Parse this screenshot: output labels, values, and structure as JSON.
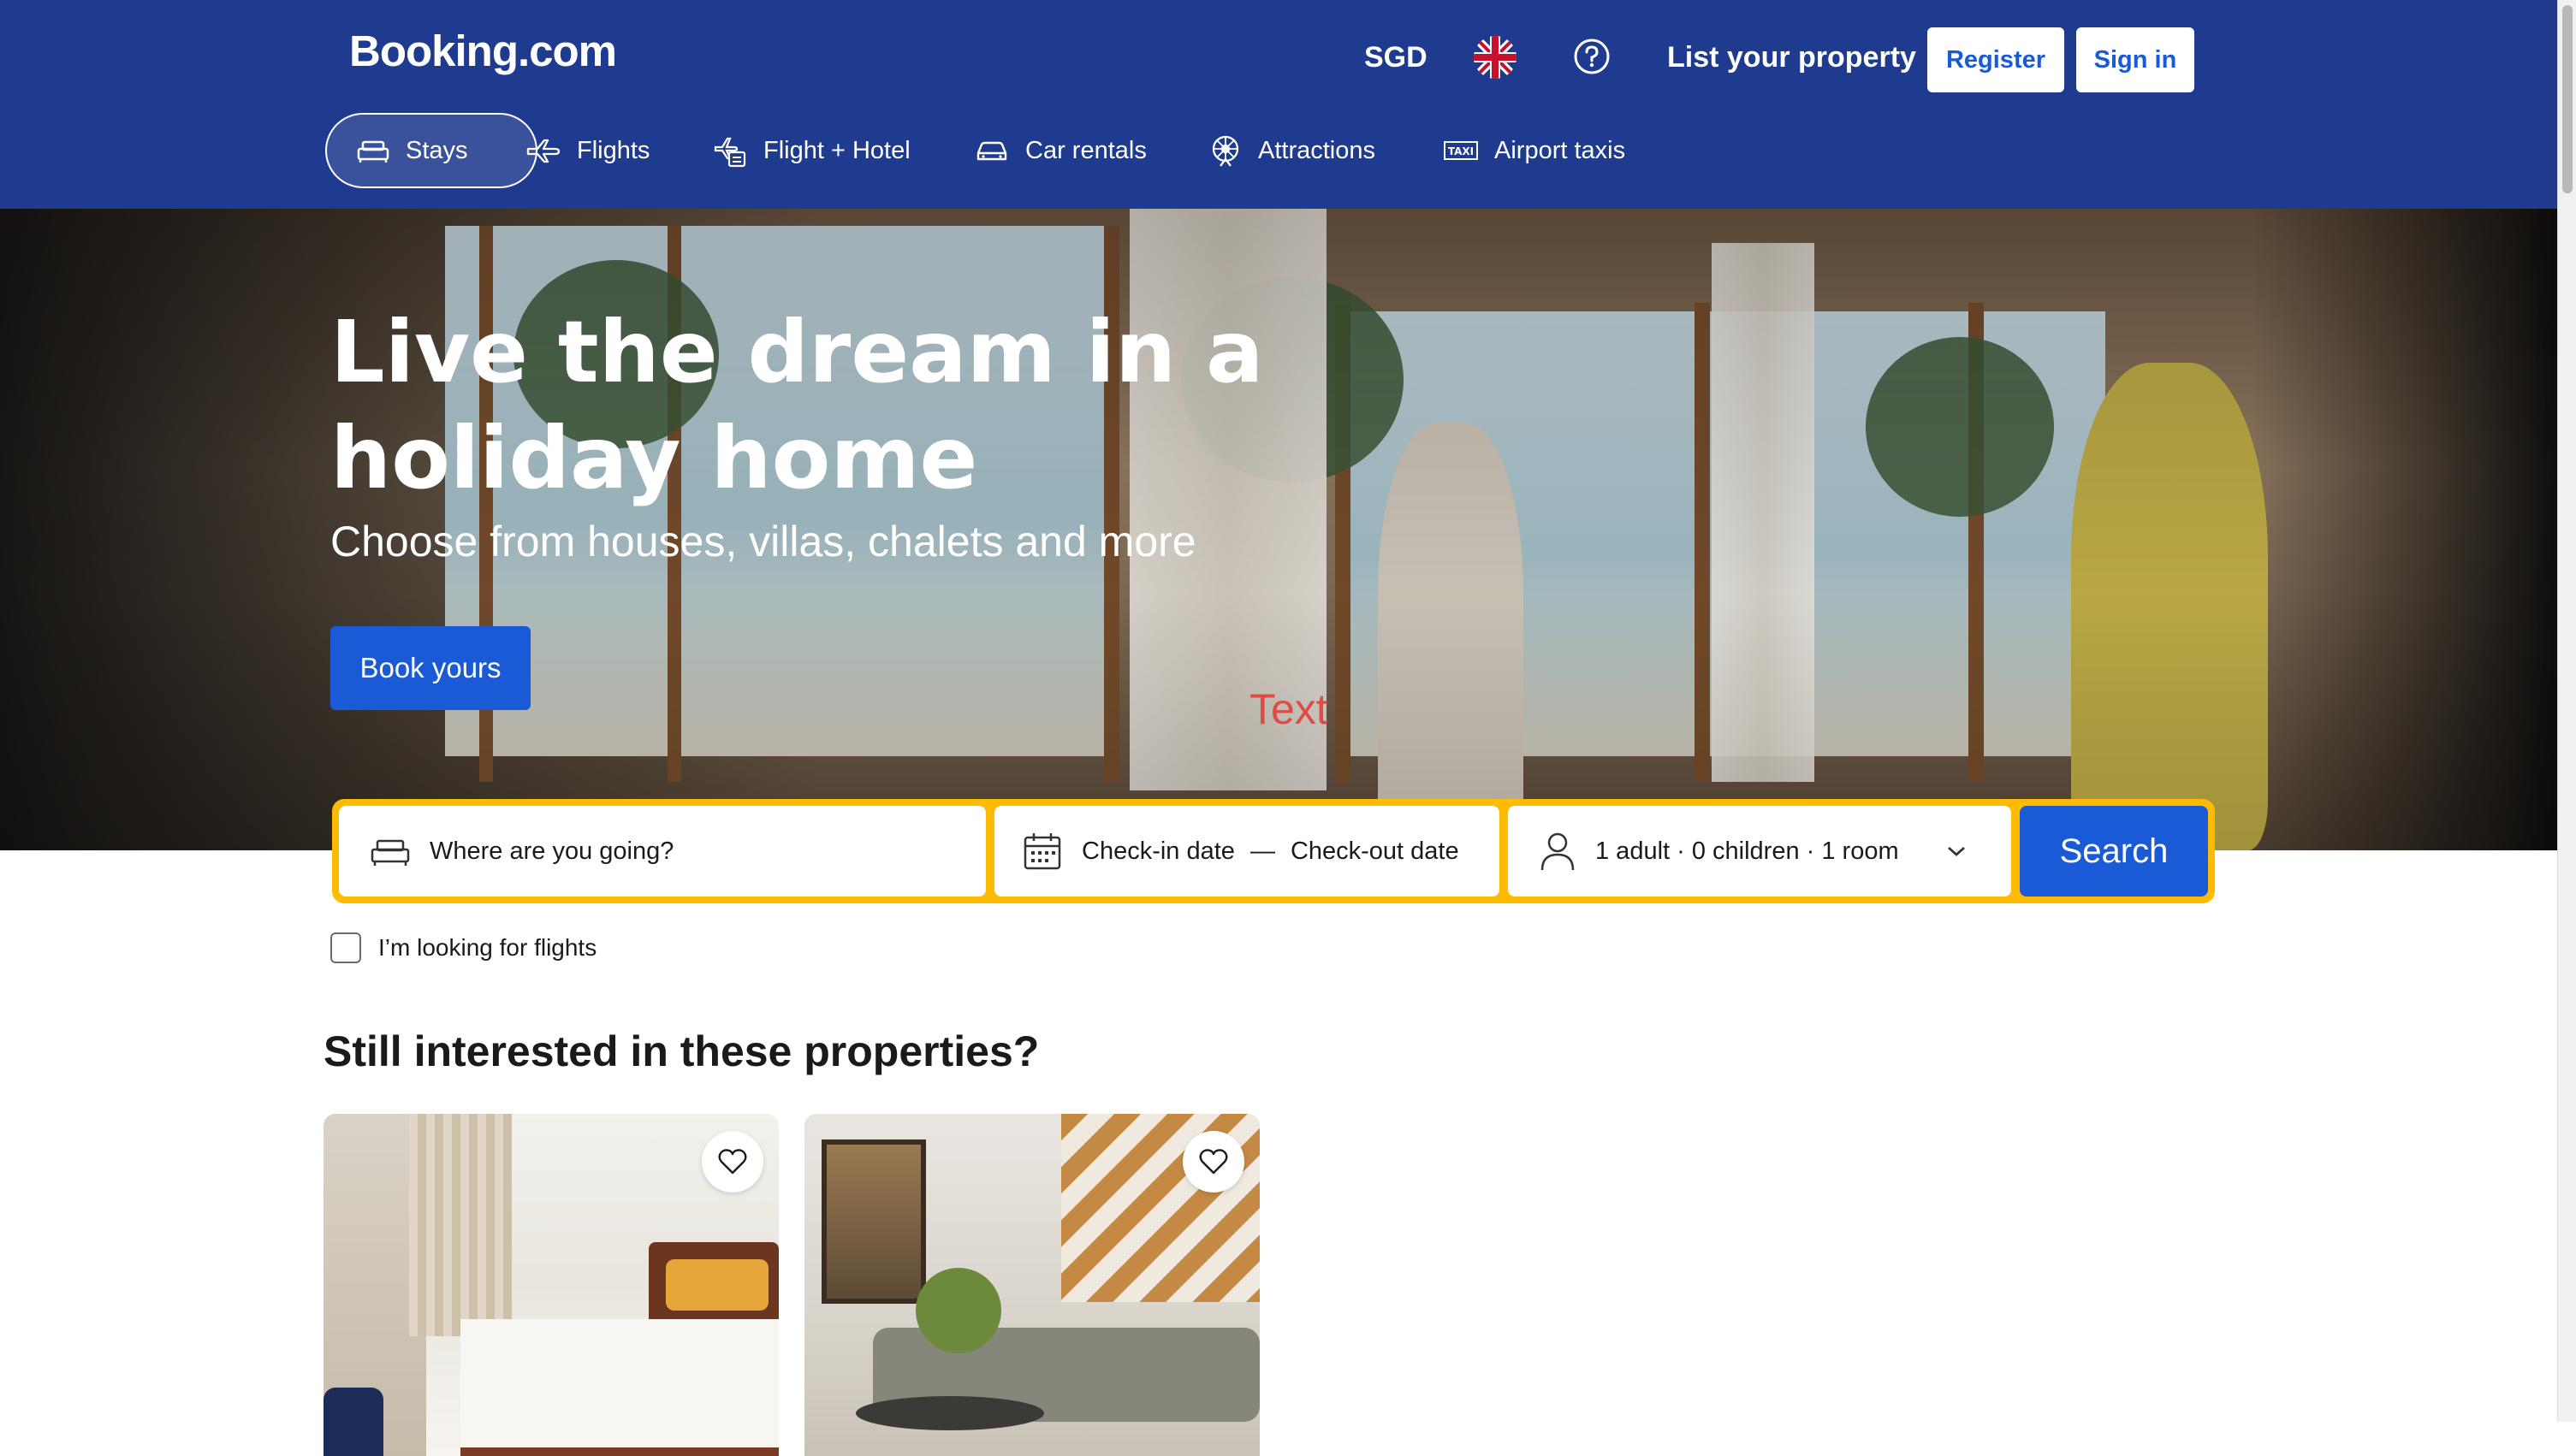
{
  "header": {
    "logo": "Booking.com",
    "currency": "SGD",
    "language_icon": "uk-flag-icon",
    "help_icon": "help-icon",
    "list_property": "List your property",
    "register": "Register",
    "sign_in": "Sign in",
    "background_color": "#1f3b8f"
  },
  "nav": {
    "tabs": [
      {
        "label": "Stays",
        "icon": "bed-icon",
        "active": true
      },
      {
        "label": "Flights",
        "icon": "plane-icon",
        "active": false
      },
      {
        "label": "Flight + Hotel",
        "icon": "flight-hotel-icon",
        "active": false
      },
      {
        "label": "Car rentals",
        "icon": "car-icon",
        "active": false
      },
      {
        "label": "Attractions",
        "icon": "attractions-icon",
        "active": false
      },
      {
        "label": "Airport taxis",
        "icon": "taxi-icon",
        "active": false
      }
    ]
  },
  "hero": {
    "title_line1": "Live the dream in a",
    "title_line2": "holiday home",
    "subtitle": "Choose from houses, villas, chalets and more",
    "cta": "Book yours",
    "overlay_text": "Text"
  },
  "search": {
    "destination_placeholder": "Where are you going?",
    "checkin": "Check-in date",
    "dash": "—",
    "checkout": "Check-out date",
    "guests": "1 adult · 0 children · 1 room",
    "button": "Search",
    "accent_color": "#febb02",
    "button_color": "#1a5ad7"
  },
  "options": {
    "flights_checkbox": "I’m looking for flights"
  },
  "properties": {
    "title": "Still interested in these properties?",
    "cards": [
      {
        "favorite_icon": "heart-icon"
      },
      {
        "favorite_icon": "heart-icon"
      }
    ]
  }
}
